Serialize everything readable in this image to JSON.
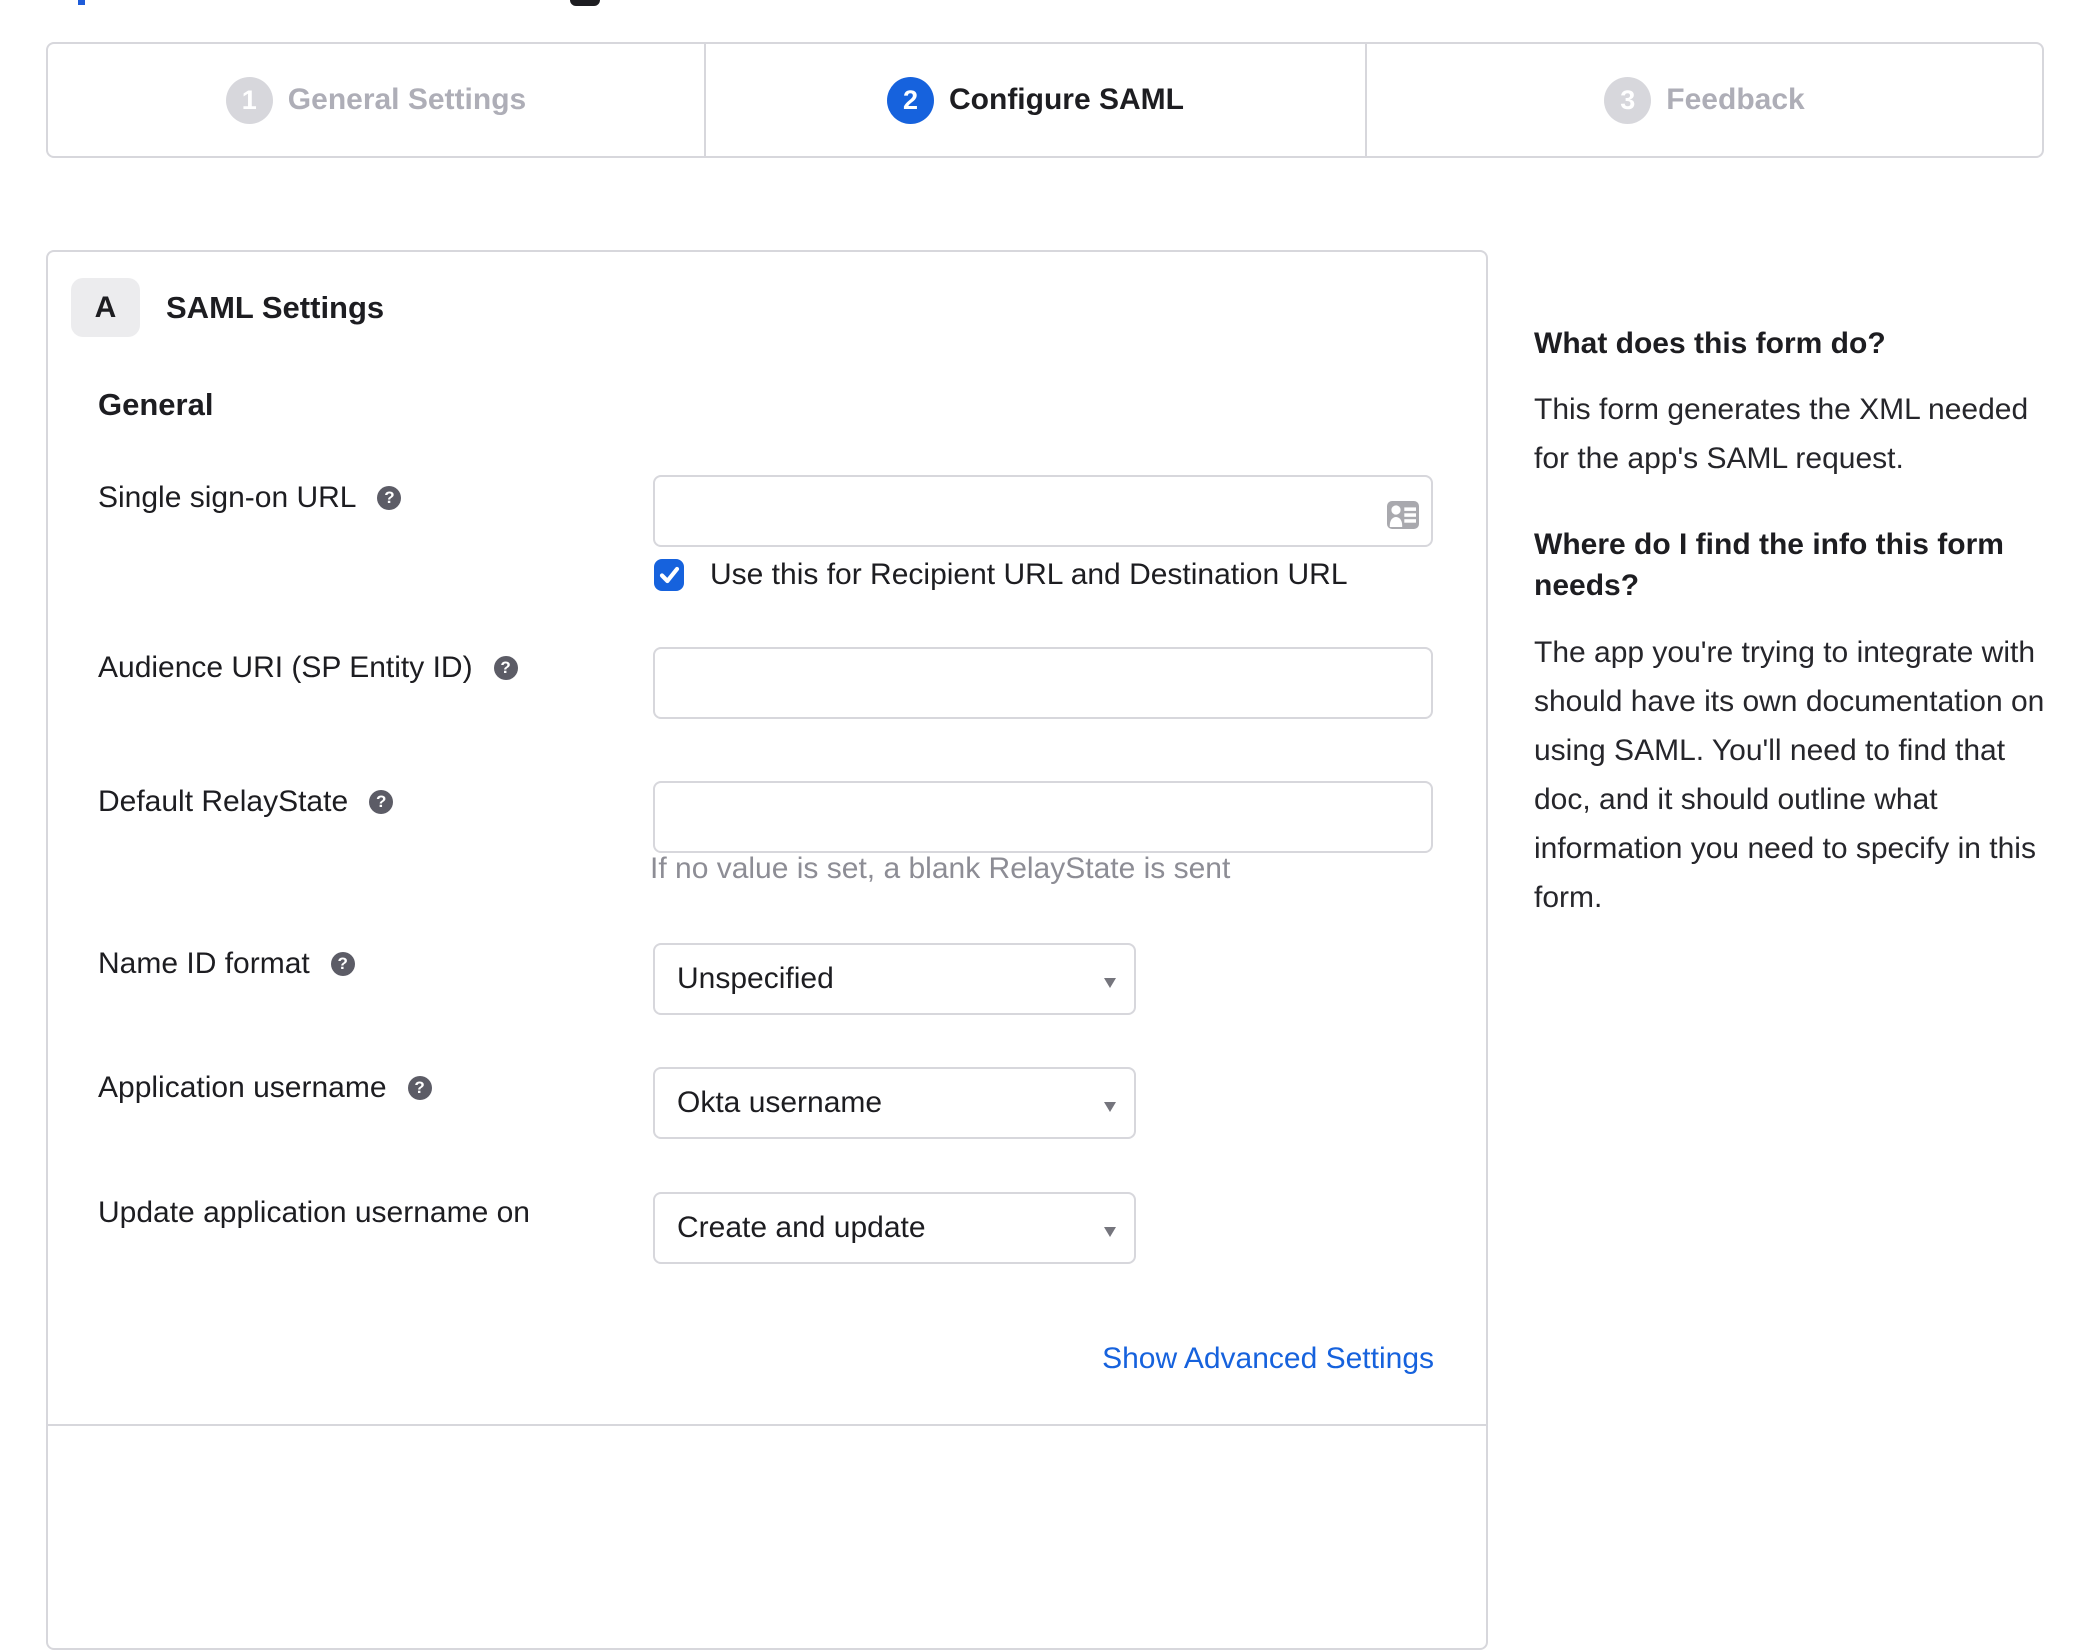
{
  "stepper": {
    "steps": [
      {
        "number": "1",
        "label": "General Settings",
        "active": false
      },
      {
        "number": "2",
        "label": "Configure SAML",
        "active": true
      },
      {
        "number": "3",
        "label": "Feedback",
        "active": false
      }
    ]
  },
  "panel": {
    "badge": "A",
    "help_icon_glyph": "?",
    "title": "SAML Settings",
    "section": "General",
    "rows": [
      {
        "label": "Single sign-on URL",
        "control": "input",
        "value": "",
        "checkbox_label": "Use this for Recipient URL and Destination URL",
        "checked": true
      },
      {
        "label": "Audience URI (SP Entity ID)",
        "control": "input",
        "value": ""
      },
      {
        "label": "Default RelayState",
        "control": "input",
        "value": "",
        "helper": "If no value is set, a blank RelayState is sent"
      },
      {
        "label": "Name ID format",
        "control": "select",
        "value": "Unspecified"
      },
      {
        "label": "Application username",
        "control": "select",
        "value": "Okta username"
      },
      {
        "label": "Update application username on",
        "control": "select",
        "value": "Create and update"
      }
    ],
    "advanced_link": "Show Advanced Settings"
  },
  "sidebar": {
    "sections": [
      {
        "heading": "What does this form do?",
        "body": "This form generates the XML needed for the app's SAML request."
      },
      {
        "heading": "Where do I find the info this form needs?",
        "body": "The app you're trying to integrate with should have its own documentation on using SAML. You'll need to find that doc, and it should outline what information you need to specify in this form."
      }
    ]
  },
  "colors": {
    "accent": "#1662dd",
    "border": "#d7d7dc",
    "text": "#1d1d21",
    "inactive": "#aeaeb7",
    "helper": "#8d8d95"
  }
}
